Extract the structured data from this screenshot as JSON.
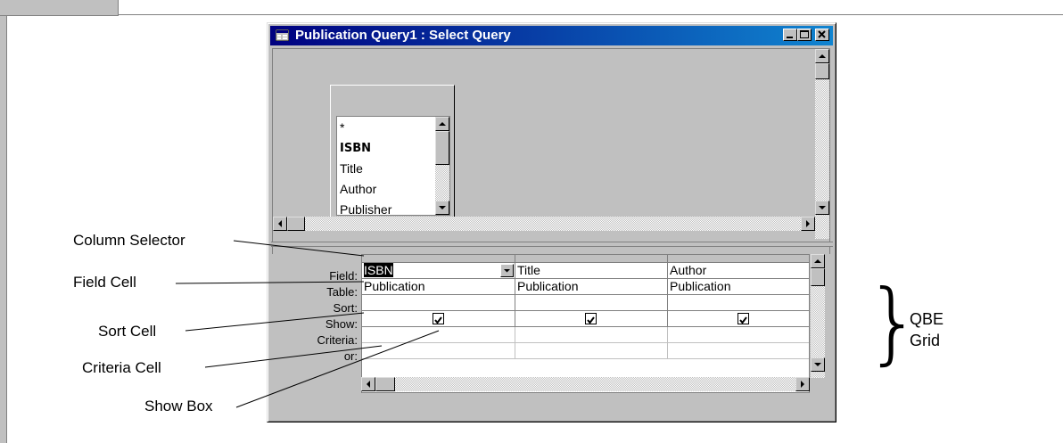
{
  "window": {
    "title": "Publication Query1 : Select Query",
    "buttons": {
      "minimize": "minimize",
      "maximize": "maximize",
      "close": "close"
    }
  },
  "field_list": {
    "items": [
      "*",
      "ISBN",
      "Title",
      "Author",
      "Publisher"
    ],
    "bold_item": "ISBN"
  },
  "grid": {
    "row_labels": [
      "Field:",
      "Table:",
      "Sort:",
      "Show:",
      "Criteria:",
      "or:"
    ],
    "columns": [
      {
        "field": "ISBN",
        "table": "Publication",
        "sort": "",
        "show": true,
        "criteria": "",
        "or": ""
      },
      {
        "field": "Title",
        "table": "Publication",
        "sort": "",
        "show": true,
        "criteria": "",
        "or": ""
      },
      {
        "field": "Author",
        "table": "Publication",
        "sort": "",
        "show": true,
        "criteria": "",
        "or": ""
      }
    ]
  },
  "callouts": {
    "column_selector": "Column Selector",
    "field_cell": "Field Cell",
    "sort_cell": "Sort Cell",
    "criteria_cell": "Criteria Cell",
    "show_box": "Show Box",
    "qbe_grid_line1": "QBE",
    "qbe_grid_line2": "Grid"
  },
  "icons": [
    "query-window-icon",
    "minimize-icon",
    "maximize-icon",
    "close-icon",
    "scroll-up-arrow-icon",
    "scroll-down-arrow-icon",
    "scroll-left-arrow-icon",
    "scroll-right-arrow-icon",
    "dropdown-arrow-icon",
    "checkmark-icon"
  ]
}
